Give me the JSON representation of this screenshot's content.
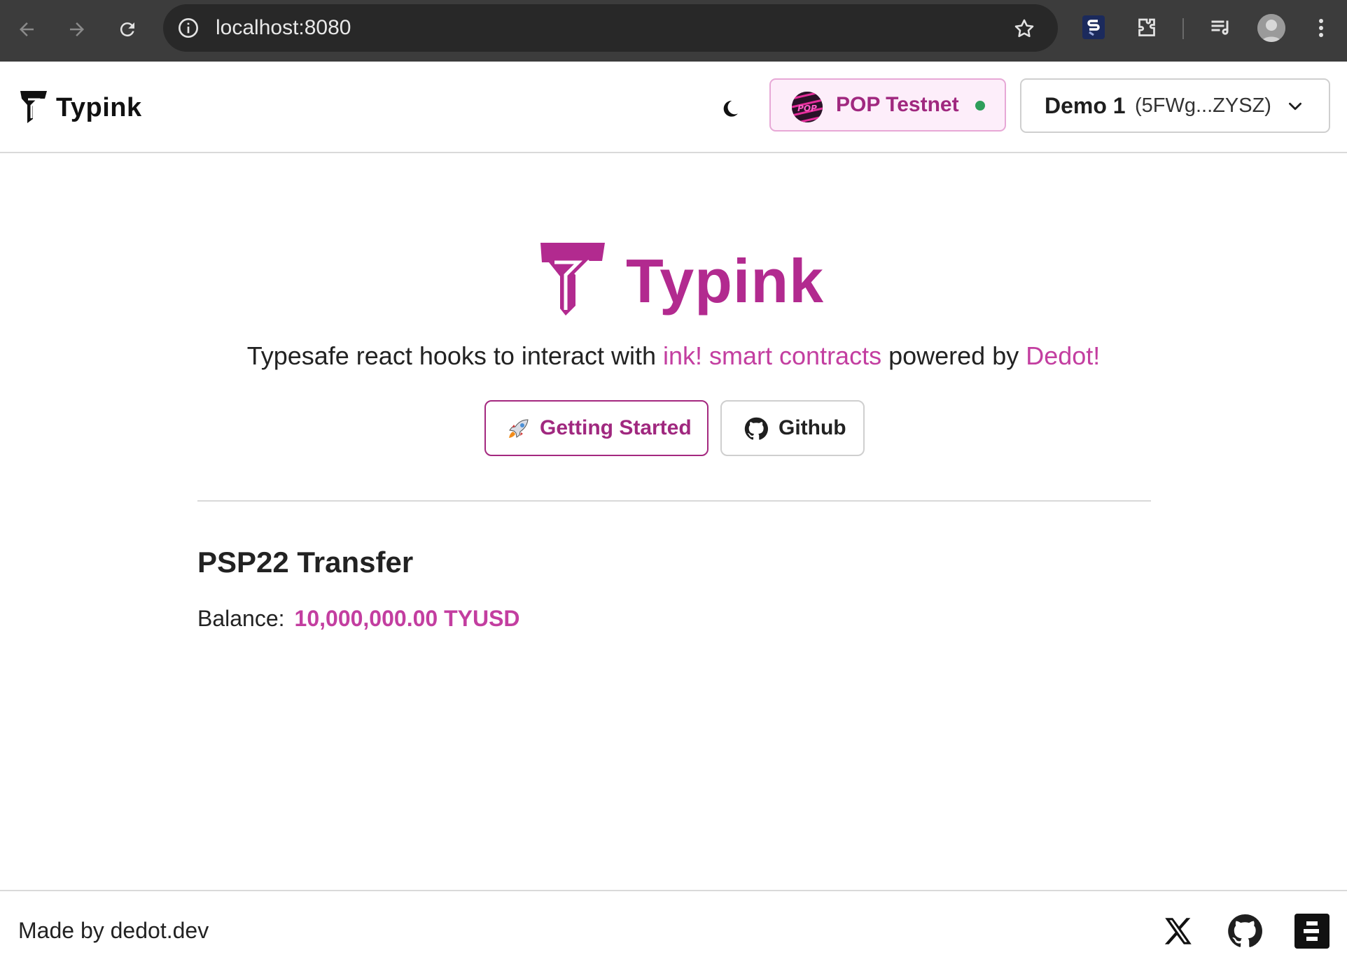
{
  "browser": {
    "url": "localhost:8080",
    "icons": [
      "back-icon",
      "forward-icon",
      "reload-icon",
      "site-info-icon",
      "bookmark-star-icon",
      "extension-s-icon",
      "extensions-puzzle-icon",
      "media-queue-icon",
      "profile-avatar",
      "more-menu-icon"
    ]
  },
  "header": {
    "brand": "Typink",
    "theme_icon": "moon-icon",
    "network": {
      "label": "POP Testnet",
      "logo_text": "POP",
      "status_color": "#2f9e5b"
    },
    "account": {
      "name": "Demo 1",
      "address": "(5FWg...ZYSZ)"
    }
  },
  "hero": {
    "title": "Typink",
    "tagline_prefix": "Typesafe react hooks to interact with ",
    "tagline_link1": "ink! smart contracts",
    "tagline_middle": " powered by ",
    "tagline_link2": "Dedot!",
    "getting_started_label": "Getting Started",
    "github_label": "Github"
  },
  "section": {
    "title": "PSP22 Transfer",
    "balance_label": "Balance:",
    "balance_value": "10,000,000.00 TYUSD"
  },
  "footer": {
    "text": "Made by dedot.dev",
    "icons": [
      "x-twitter-icon",
      "github-icon",
      "dedot-logo-icon"
    ]
  },
  "colors": {
    "brand_pink": "#b22a8f",
    "accent_pink": "#c33ea0",
    "chrome_dark": "#3c3c3c"
  }
}
